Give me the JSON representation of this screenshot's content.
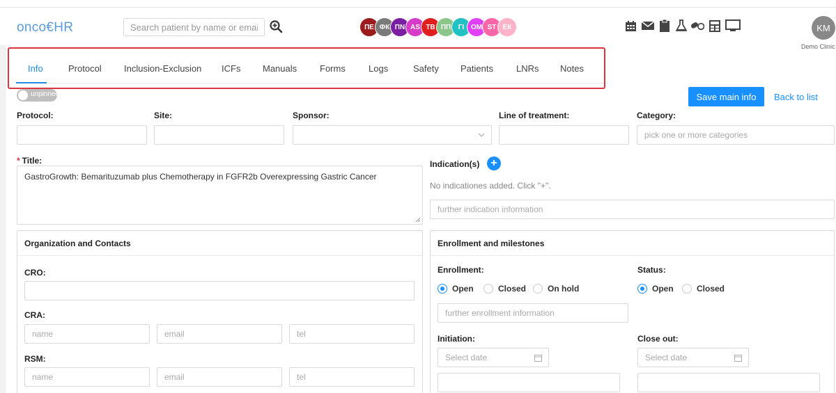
{
  "header": {
    "logo": "onco€HR",
    "search_placeholder": "Search patient by name or email",
    "user_initials": "KM",
    "clinic": "Demo Clinic"
  },
  "recent_patients": [
    {
      "initials": "ПЕ",
      "color": "#9b1c1c"
    },
    {
      "initials": "ФК",
      "color": "#7a7a7a"
    },
    {
      "initials": "ПN",
      "color": "#7b1fa2"
    },
    {
      "initials": "AS",
      "color": "#d63cc8"
    },
    {
      "initials": "TB",
      "color": "#e02020"
    },
    {
      "initials": "ПП",
      "color": "#8bc78b"
    },
    {
      "initials": "ГІ",
      "color": "#22c1c3"
    },
    {
      "initials": "ОМ",
      "color": "#e040fb"
    },
    {
      "initials": "ST",
      "color": "#ff66a8"
    },
    {
      "initials": "ЕК",
      "color": "#ffb3c8"
    }
  ],
  "tool_icons": [
    "calendar-icon",
    "mail-icon",
    "clipboard-icon",
    "flask-icon",
    "pills-icon",
    "calculator-icon",
    "monitor-icon"
  ],
  "tabs": [
    "Info",
    "Protocol",
    "Inclusion-Exclusion",
    "ICFs",
    "Manuals",
    "Forms",
    "Logs",
    "Safety",
    "Patients",
    "LNRs",
    "Notes"
  ],
  "active_tab": "Info",
  "pin_toggle": "unpinned",
  "actions": {
    "save": "Save main info",
    "back": "Back to list"
  },
  "fields": {
    "protocol": "Protocol",
    "site": "Site",
    "sponsor": "Sponsor",
    "line_of_treatment": "Line of treatment",
    "category": "Category",
    "category_placeholder": "pick one or more categories",
    "title_label": "Title",
    "title_value": "GastroGrowth: Bemarituzumab plus Chemotherapy in FGFR2b Overexpressing Gastric Cancer",
    "indications": "Indication(s)",
    "no_indications": "No indicationes added. Click \"+\".",
    "further_indication": "further indication information"
  },
  "org_panel": {
    "title": "Organization and Contacts",
    "cro": "CRO",
    "cra": "CRA",
    "rsm": "RSM",
    "name_ph": "name",
    "email_ph": "email",
    "tel_ph": "tel"
  },
  "enroll_panel": {
    "title": "Enrollment and milestones",
    "enrollment": "Enrollment",
    "enroll_options": [
      "Open",
      "Closed",
      "On hold"
    ],
    "enroll_selected": "Open",
    "status": "Status",
    "status_options": [
      "Open",
      "Closed"
    ],
    "status_selected": "Open",
    "further_enrollment": "further enrollment information",
    "initiation": "Initiation",
    "close_out": "Close out",
    "date_ph": "Select date"
  }
}
